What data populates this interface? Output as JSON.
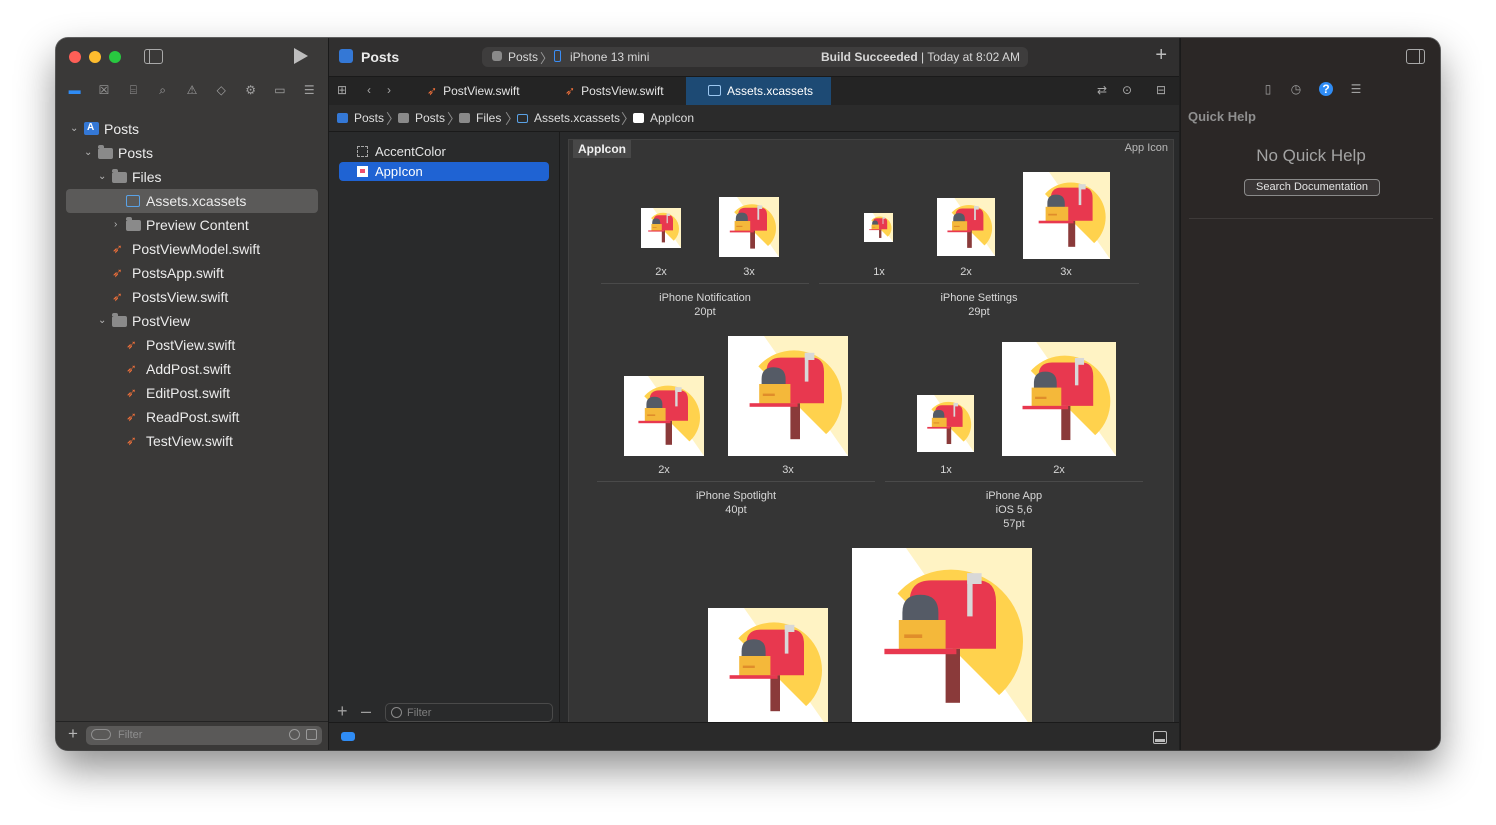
{
  "toolbar": {
    "scheme_title": "Posts",
    "status_project": "Posts",
    "status_device": "iPhone 13 mini",
    "build_status_strong": "Build Succeeded",
    "build_status_time": "| Today at 8:02 AM"
  },
  "navigator": {
    "tree": [
      {
        "label": "Posts",
        "icon": "project-icon"
      },
      {
        "label": "Posts",
        "icon": "folder-icon"
      },
      {
        "label": "Files",
        "icon": "folder-icon"
      },
      {
        "label": "Assets.xcassets",
        "icon": "asset-catalog-icon",
        "selected": true
      },
      {
        "label": "Preview Content",
        "icon": "folder-icon"
      },
      {
        "label": "PostViewModel.swift",
        "icon": "swift-file-icon"
      },
      {
        "label": "PostsApp.swift",
        "icon": "swift-file-icon"
      },
      {
        "label": "PostsView.swift",
        "icon": "swift-file-icon"
      },
      {
        "label": "PostView",
        "icon": "folder-icon"
      },
      {
        "label": "PostView.swift",
        "icon": "swift-file-icon"
      },
      {
        "label": "AddPost.swift",
        "icon": "swift-file-icon"
      },
      {
        "label": "EditPost.swift",
        "icon": "swift-file-icon"
      },
      {
        "label": "ReadPost.swift",
        "icon": "swift-file-icon"
      },
      {
        "label": "TestView.swift",
        "icon": "swift-file-icon"
      }
    ],
    "filter_placeholder": "Filter"
  },
  "tabs": [
    {
      "label": "PostView.swift",
      "active": false
    },
    {
      "label": "PostsView.swift",
      "active": false
    },
    {
      "label": "Assets.xcassets",
      "active": true
    }
  ],
  "jumpbar": [
    "Posts",
    "Posts",
    "Files",
    "Assets.xcassets",
    "AppIcon"
  ],
  "asset_list": {
    "items": [
      {
        "label": "AccentColor",
        "selected": false
      },
      {
        "label": "AppIcon",
        "selected": true
      }
    ],
    "filter_placeholder": "Filter"
  },
  "asset_canvas": {
    "title": "AppIcon",
    "kind": "App Icon",
    "groups": [
      {
        "name": "iPhone Notification",
        "size": "20pt",
        "scales": [
          "2x",
          "3x"
        ]
      },
      {
        "name": "iPhone Settings",
        "size": "29pt",
        "scales": [
          "1x",
          "2x",
          "3x"
        ]
      },
      {
        "name": "iPhone Spotlight",
        "size": "40pt",
        "scales": [
          "2x",
          "3x"
        ]
      },
      {
        "name": "iPhone App",
        "sub": "iOS 5,6",
        "size": "57pt",
        "scales": [
          "1x",
          "2x"
        ]
      }
    ]
  },
  "inspector": {
    "title": "Quick Help",
    "empty_message": "No Quick Help",
    "search_button": "Search Documentation"
  },
  "colors": {
    "accent": "#2f8cf5",
    "selection": "#1f63d3",
    "swift": "#f0703a",
    "mailbox_red": "#e8384f",
    "sunburst": "#ffd24d"
  }
}
